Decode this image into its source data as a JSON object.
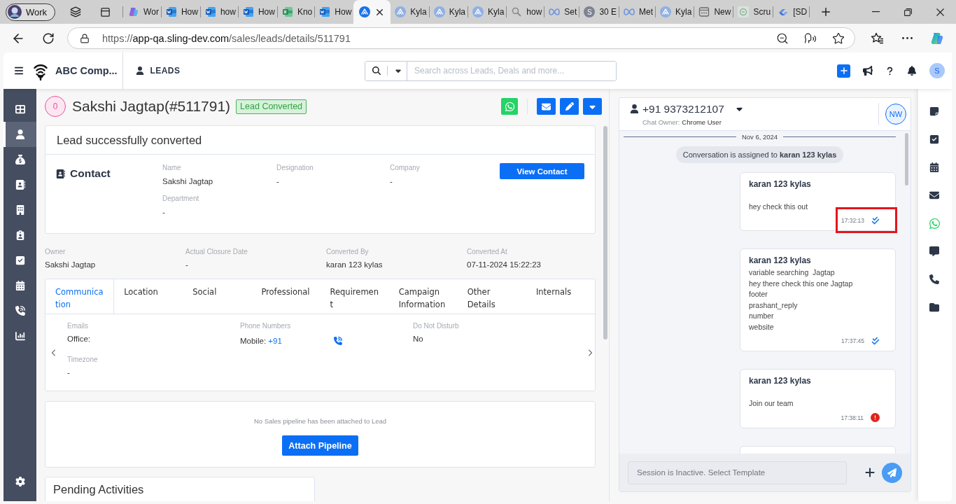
{
  "browser": {
    "profile": "Work",
    "tabs": [
      {
        "kind": "copilot",
        "title": "Wor",
        "selected": false
      },
      {
        "kind": "word",
        "title": "How",
        "selected": false
      },
      {
        "kind": "word",
        "title": "how",
        "selected": false
      },
      {
        "kind": "word",
        "title": "How",
        "selected": false
      },
      {
        "kind": "excel",
        "title": "Kno",
        "selected": false
      },
      {
        "kind": "word",
        "title": "How",
        "selected": false
      },
      {
        "kind": "kylas",
        "selected": true
      },
      {
        "kind": "kylas",
        "title": "Kyla",
        "selected": false
      },
      {
        "kind": "kylas",
        "title": "Kyla",
        "selected": false
      },
      {
        "kind": "kylas",
        "title": "Kyla",
        "selected": false
      },
      {
        "kind": "search",
        "title": "how",
        "selected": false
      },
      {
        "kind": "meta",
        "title": "Set",
        "selected": false
      },
      {
        "kind": "letter",
        "letter": "S",
        "title": "30 E",
        "selected": false
      },
      {
        "kind": "meta",
        "title": "Met",
        "selected": false
      },
      {
        "kind": "kylas",
        "title": "Kyla",
        "selected": false
      },
      {
        "kind": "page",
        "title": "New",
        "selected": false
      },
      {
        "kind": "image",
        "title": "Scru",
        "selected": false
      },
      {
        "kind": "jira",
        "title": "[SD",
        "selected": false
      }
    ],
    "url_scheme": "https://",
    "url_host": "app-qa.sling-dev.com",
    "url_path": "/sales/leads/details/511791"
  },
  "header": {
    "company": "ABC Comp...",
    "module": "LEADS",
    "search_placeholder": "Search across Leads, Deals and more...",
    "avatar": "S"
  },
  "nav": [
    {
      "kind": "dashboard",
      "selected": false
    },
    {
      "kind": "leads",
      "selected": true
    },
    {
      "kind": "deals",
      "selected": false
    },
    {
      "kind": "contacts",
      "selected": false
    },
    {
      "kind": "companies",
      "selected": false
    },
    {
      "kind": "clipboard",
      "selected": false
    },
    {
      "kind": "tasks",
      "selected": false
    },
    {
      "kind": "calendar",
      "selected": false
    },
    {
      "kind": "calls",
      "selected": false
    },
    {
      "kind": "reports",
      "selected": false
    }
  ],
  "lead": {
    "score": "0",
    "title": "Sakshi Jagtap(#511791)",
    "status": "Lead Converted"
  },
  "conversion": {
    "heading": "Lead successfully converted",
    "section_title": "Contact",
    "fields": [
      {
        "label": "Name",
        "value": "Sakshi Jagtap"
      },
      {
        "label": "Designation",
        "value": "-"
      },
      {
        "label": "Company",
        "value": "-"
      },
      {
        "label": "Department",
        "value": "-"
      }
    ],
    "action": "View Contact"
  },
  "summary": [
    {
      "label": "Owner",
      "value": "Sakshi Jagtap"
    },
    {
      "label": "Actual Closure Date",
      "value": "-"
    },
    {
      "label": "Converted By",
      "value": "karan 123 kylas"
    },
    {
      "label": "Converted At",
      "value": "07-11-2024 15:22:23"
    }
  ],
  "details": {
    "tabs": [
      {
        "label": "Communication",
        "selected": true
      },
      {
        "label": "Location",
        "selected": false
      },
      {
        "label": "Social",
        "selected": false
      },
      {
        "label": "Professional",
        "selected": false
      },
      {
        "label": "Requirement",
        "selected": false
      },
      {
        "label": "Campaign Information",
        "selected": false
      },
      {
        "label": "Other Details",
        "selected": false
      },
      {
        "label": "Internals",
        "selected": false
      }
    ],
    "fields": [
      {
        "kind": "text",
        "label": "Emails",
        "value": "Office:"
      },
      {
        "kind": "phone",
        "label": "Phone Numbers",
        "value": "Mobile:",
        "link": "+91"
      },
      {
        "kind": "text",
        "label": "Do Not Disturb",
        "value": "No"
      },
      {
        "kind": "text",
        "label": "Timezone",
        "value": "-"
      }
    ]
  },
  "pipeline": {
    "message": "No Sales pipeline has been attached to Lead",
    "action": "Attach Pipeline"
  },
  "activities": {
    "title": "Pending Activities"
  },
  "chat": {
    "phone": "+91 9373212107",
    "owner_label": "Chat Owner:",
    "owner": "Chrome User",
    "avatar": "NW",
    "date": "Nov 6, 2024",
    "system_message": "Conversation is assigned to **karan 123 kylas**",
    "messages": [
      {
        "sender": "karan 123 kylas",
        "blank_line": true,
        "lines": [
          "hey check this out"
        ],
        "time": "17:32:13",
        "failed": false,
        "highlighted": true
      },
      {
        "sender": "karan 123 kylas",
        "blank_line": false,
        "lines": [
          "variable searching  Jagtap",
          "hey there check this one Jagtap",
          "footer",
          "prashant_reply",
          "number",
          "website"
        ],
        "time": "17:37:45",
        "failed": false,
        "highlighted": false
      },
      {
        "sender": "karan 123 kylas",
        "blank_line": true,
        "lines": [
          "Join our team"
        ],
        "time": "17:38:11",
        "failed": true,
        "highlighted": false
      }
    ],
    "more_below": true,
    "composer_placeholder": "Session is Inactive. Select Template"
  },
  "right_rail": [
    {
      "kind": "note"
    },
    {
      "kind": "task"
    },
    {
      "kind": "calendar"
    },
    {
      "kind": "email"
    },
    {
      "kind": "whatsapp"
    },
    {
      "kind": "message"
    },
    {
      "kind": "call"
    },
    {
      "kind": "files"
    }
  ]
}
